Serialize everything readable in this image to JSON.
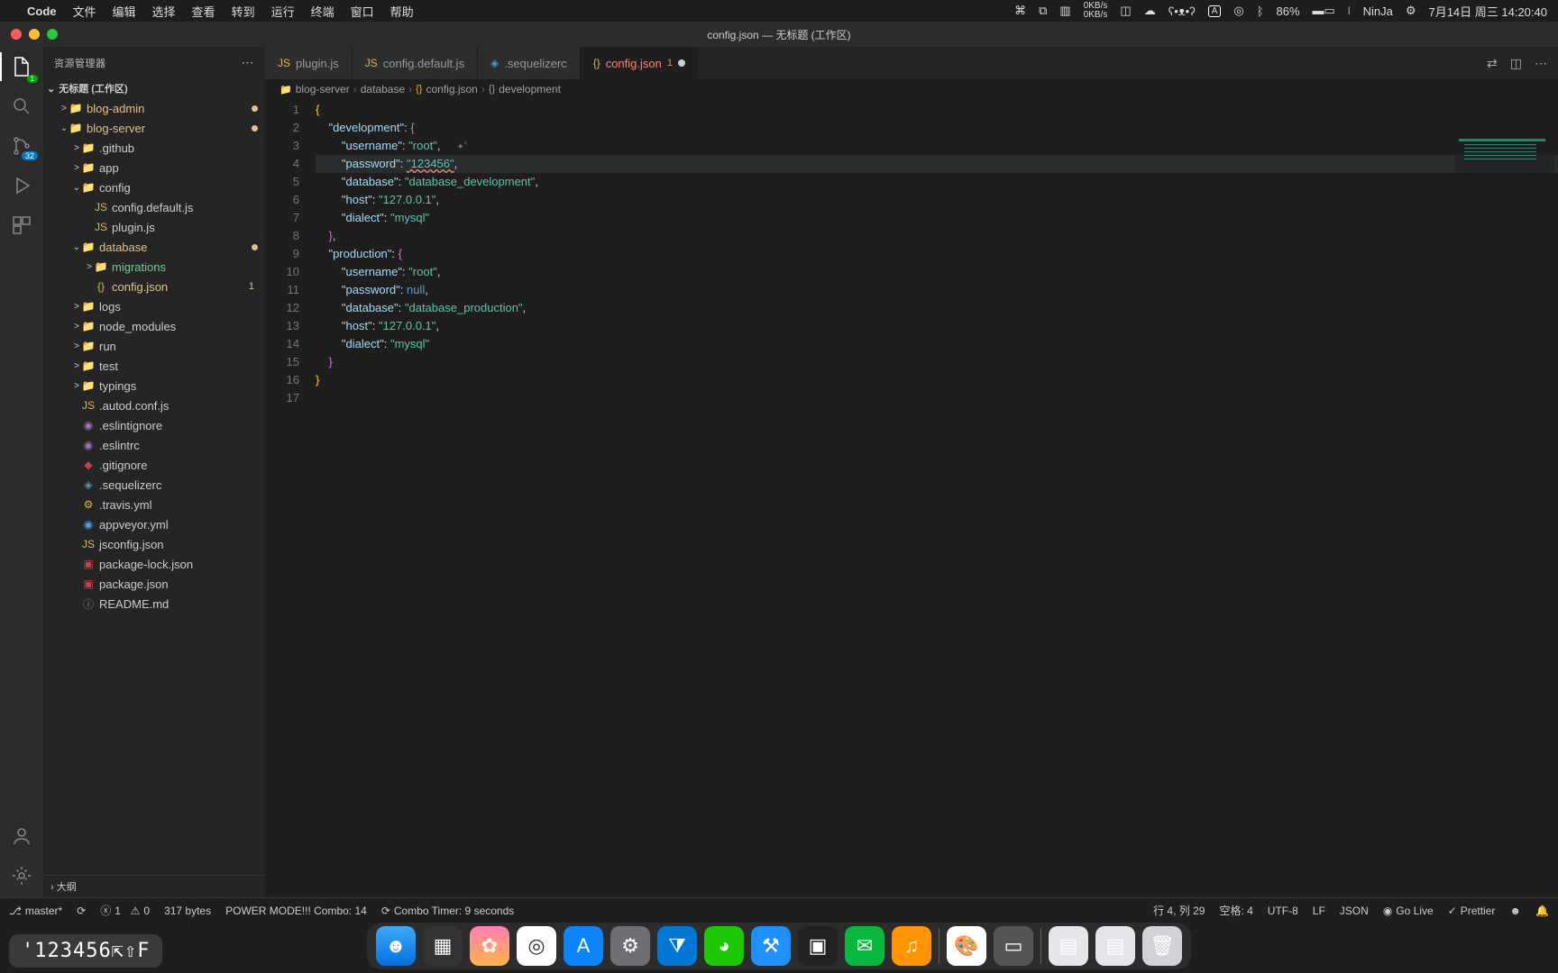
{
  "menubar": {
    "app": "Code",
    "items": [
      "文件",
      "编辑",
      "选择",
      "查看",
      "转到",
      "运行",
      "终端",
      "窗口",
      "帮助"
    ],
    "right": {
      "net_up": "0KB/s",
      "net_down": "0KB/s",
      "input": "A",
      "battery": "86%",
      "user": "NinJa",
      "date": "7月14日 周三 14:20:40"
    }
  },
  "window": {
    "title": "config.json — 无标题 (工作区)"
  },
  "sidebar": {
    "title": "资源管理器",
    "workspace": "无标题 (工作区)",
    "outline": "大纲",
    "scm_badge": "32",
    "tree": [
      {
        "depth": 1,
        "chev": ">",
        "ico": "📁",
        "name": "blog-admin",
        "cls": "mod",
        "dot": true
      },
      {
        "depth": 1,
        "chev": "⌄",
        "ico": "📁",
        "name": "blog-server",
        "cls": "mod",
        "dot": true
      },
      {
        "depth": 2,
        "chev": ">",
        "ico": "📁",
        "name": ".github"
      },
      {
        "depth": 2,
        "chev": ">",
        "ico": "📁",
        "name": "app"
      },
      {
        "depth": 2,
        "chev": "⌄",
        "ico": "📁",
        "name": "config"
      },
      {
        "depth": 3,
        "ico": "JS",
        "icocls": "ic-yellow",
        "name": "config.default.js"
      },
      {
        "depth": 3,
        "ico": "JS",
        "icocls": "ic-yellow",
        "name": "plugin.js"
      },
      {
        "depth": 2,
        "chev": "⌄",
        "ico": "📁",
        "name": "database",
        "cls": "mod",
        "dot": true
      },
      {
        "depth": 3,
        "chev": ">",
        "ico": "📁",
        "name": "migrations",
        "cls": "git-u"
      },
      {
        "depth": 3,
        "ico": "{}",
        "icocls": "ic-yellow",
        "name": "config.json",
        "cls": "mod",
        "badge_num": "1"
      },
      {
        "depth": 2,
        "chev": ">",
        "ico": "📁",
        "name": "logs"
      },
      {
        "depth": 2,
        "chev": ">",
        "ico": "📁",
        "name": "node_modules"
      },
      {
        "depth": 2,
        "chev": ">",
        "ico": "📁",
        "name": "run"
      },
      {
        "depth": 2,
        "chev": ">",
        "ico": "📁",
        "name": "test"
      },
      {
        "depth": 2,
        "chev": ">",
        "ico": "📁",
        "name": "typings"
      },
      {
        "depth": 2,
        "ico": "JS",
        "icocls": "ic-yellow",
        "name": ".autod.conf.js"
      },
      {
        "depth": 2,
        "ico": "◉",
        "icocls": "ic-purple",
        "name": ".eslintignore"
      },
      {
        "depth": 2,
        "ico": "◉",
        "icocls": "ic-purple",
        "name": ".eslintrc"
      },
      {
        "depth": 2,
        "ico": "◆",
        "icocls": "ic-red",
        "name": ".gitignore"
      },
      {
        "depth": 2,
        "ico": "◈",
        "icocls": "ic-teal",
        "name": ".sequelizerc"
      },
      {
        "depth": 2,
        "ico": "⚙",
        "icocls": "ic-yellow",
        "name": ".travis.yml"
      },
      {
        "depth": 2,
        "ico": "◉",
        "icocls": "ic-cyan",
        "name": "appveyor.yml"
      },
      {
        "depth": 2,
        "ico": "JS",
        "icocls": "ic-yellow",
        "name": "jsconfig.json"
      },
      {
        "depth": 2,
        "ico": "▣",
        "icocls": "ic-red",
        "name": "package-lock.json"
      },
      {
        "depth": 2,
        "ico": "▣",
        "icocls": "ic-red",
        "name": "package.json"
      },
      {
        "depth": 2,
        "ico": "ⓘ",
        "icocls": "ic-teal",
        "name": "README.md"
      }
    ]
  },
  "tabs": [
    {
      "ico": "JS",
      "icocls": "ic-yellow",
      "name": "plugin.js"
    },
    {
      "ico": "JS",
      "icocls": "ic-yellow",
      "name": "config.default.js"
    },
    {
      "ico": "◈",
      "icocls": "ic-teal",
      "name": ".sequelizerc"
    },
    {
      "ico": "{}",
      "icocls": "ic-yellow",
      "name": "config.json",
      "active": true,
      "badge": "1",
      "modified": true,
      "err": true
    }
  ],
  "breadcrumbs": [
    "blog-server",
    "database",
    "config.json",
    "development"
  ],
  "code": {
    "lines": [
      {
        "n": 1,
        "html": "<span class='tok-brace'>{</span>"
      },
      {
        "n": 2,
        "html": "    <span class='tok-key'>\"development\"</span><span class='tok-punc'>: </span><span class='tok-brace2'>{</span>"
      },
      {
        "n": 3,
        "html": "        <span class='tok-key'>\"username\"</span><span class='tok-punc'>: </span><span class='tok-strg'>\"root\"</span><span class='tok-punc'>,</span><span class='cursor-hint'>✦˚</span>"
      },
      {
        "n": 4,
        "hl": true,
        "html": "        <span class='tok-key'>\"password\"</span><span class='tok-punc'>: </span><span class='tok-strg err-underline'>\"123456\"</span><span class='tok-punc'>,</span>"
      },
      {
        "n": 5,
        "html": "        <span class='tok-key'>\"database\"</span><span class='tok-punc'>: </span><span class='tok-strg'>\"database_development\"</span><span class='tok-punc'>,</span>"
      },
      {
        "n": 6,
        "html": "        <span class='tok-key'>\"host\"</span><span class='tok-punc'>: </span><span class='tok-strg'>\"127.0.0.1\"</span><span class='tok-punc'>,</span>"
      },
      {
        "n": 7,
        "html": "        <span class='tok-key'>\"dialect\"</span><span class='tok-punc'>: </span><span class='tok-strg'>\"mysql\"</span>"
      },
      {
        "n": 8,
        "html": "    <span class='tok-brace2'>}</span><span class='tok-punc'>,</span>"
      },
      {
        "n": 9,
        "html": "    <span class='tok-key'>\"production\"</span><span class='tok-punc'>: </span><span class='tok-brace2'>{</span>"
      },
      {
        "n": 10,
        "html": "        <span class='tok-key'>\"username\"</span><span class='tok-punc'>: </span><span class='tok-strg'>\"root\"</span><span class='tok-punc'>,</span>"
      },
      {
        "n": 11,
        "html": "        <span class='tok-key'>\"password\"</span><span class='tok-punc'>: </span><span class='tok-null'>null</span><span class='tok-punc'>,</span>"
      },
      {
        "n": 12,
        "html": "        <span class='tok-key'>\"database\"</span><span class='tok-punc'>: </span><span class='tok-strg'>\"database_production\"</span><span class='tok-punc'>,</span>"
      },
      {
        "n": 13,
        "html": "        <span class='tok-key'>\"host\"</span><span class='tok-punc'>: </span><span class='tok-strg'>\"127.0.0.1\"</span><span class='tok-punc'>,</span>"
      },
      {
        "n": 14,
        "html": "        <span class='tok-key'>\"dialect\"</span><span class='tok-punc'>: </span><span class='tok-strg'>\"mysql\"</span>"
      },
      {
        "n": 15,
        "html": "    <span class='tok-brace2'>}</span>"
      },
      {
        "n": 16,
        "html": "<span class='tok-brace'>}</span>"
      },
      {
        "n": 17,
        "html": ""
      }
    ]
  },
  "statusbar": {
    "branch": "master*",
    "errors": "1",
    "warnings": "0",
    "size": "317 bytes",
    "power": "POWER MODE!!! Combo: 14",
    "timer": "Combo Timer: 9 seconds",
    "pos": "行 4, 列 29",
    "spaces": "空格: 4",
    "encoding": "UTF-8",
    "eol": "LF",
    "lang": "JSON",
    "golive": "Go Live",
    "prettier": "Prettier"
  },
  "ime": "'123456⇱⇧F"
}
